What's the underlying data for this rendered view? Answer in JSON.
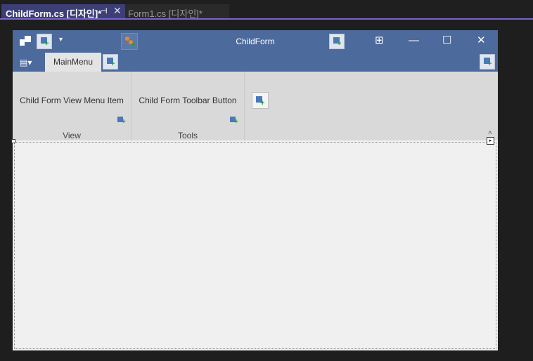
{
  "tabs": [
    {
      "label": "ChildForm.cs [디자인]*",
      "active": true
    },
    {
      "label": "Form1.cs [디자인]*",
      "active": false
    }
  ],
  "form": {
    "title": "ChildForm"
  },
  "ribbon": {
    "page_tab": "MainMenu",
    "groups": [
      {
        "item": "Child Form View Menu Item",
        "caption": "View"
      },
      {
        "item": "Child Form Toolbar Button",
        "caption": "Tools"
      }
    ]
  },
  "colors": {
    "titlebar": "#4c6a9b",
    "tab_active_bg": "#3c3f75",
    "tab_accent_line": "#7a64c8"
  }
}
